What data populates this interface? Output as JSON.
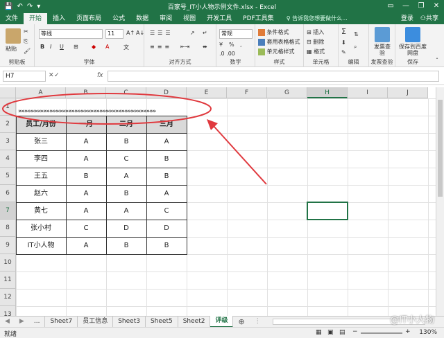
{
  "window": {
    "title": "百家号_IT小人物示例文件.xlsx - Excel",
    "controls": [
      "▭",
      "—",
      "❐",
      "✕"
    ]
  },
  "quick_access": {
    "save": "💾",
    "undo": "↶",
    "redo": "↷",
    "more": "▾"
  },
  "ribbon_tabs": [
    "文件",
    "开始",
    "插入",
    "页面布局",
    "公式",
    "数据",
    "审阅",
    "视图",
    "开发工具",
    "PDF工具集"
  ],
  "active_tab": "开始",
  "tell_me": "告诉我您想要做什么...",
  "account": {
    "login": "登录",
    "share": "共享"
  },
  "ribbon": {
    "clipboard": {
      "paste": "粘贴",
      "label": "剪贴板"
    },
    "font": {
      "name": "等线",
      "size": "11",
      "label": "字体",
      "bold": "B",
      "italic": "I",
      "underline": "U"
    },
    "alignment": {
      "label": "对齐方式"
    },
    "number": {
      "format": "常规",
      "percent": "%",
      "comma": ",",
      "label": "数字"
    },
    "styles": {
      "conditional": "条件格式",
      "table": "套用表格格式",
      "cell": "单元格样式",
      "label": "样式"
    },
    "cells": {
      "insert": "插入",
      "delete": "删除",
      "format": "格式",
      "label": "单元格"
    },
    "editing": {
      "sum": "Σ",
      "label": "编辑"
    },
    "invoice": {
      "check": "发票查验",
      "label": "发票查验"
    },
    "save": {
      "baidu": "保存到百度网盘",
      "label": "保存"
    }
  },
  "formula_bar": {
    "name_box": "H7",
    "fx": "fx",
    "value": ""
  },
  "columns": [
    "A",
    "B",
    "C",
    "D",
    "E",
    "F",
    "G",
    "H",
    "I",
    "J"
  ],
  "selected_column": "H",
  "rows": [
    "1",
    "2",
    "3",
    "4",
    "5",
    "6",
    "7",
    "8",
    "9",
    "10",
    "11",
    "12",
    "13"
  ],
  "row1_text": "»»»»»»»»»»»»»»»»»»»»»»»»»»»»»»»»»»»»»»»»»»»»",
  "table": {
    "headers": [
      "员工/月份",
      "一月",
      "二月",
      "三月"
    ],
    "rows": [
      [
        "张三",
        "A",
        "B",
        "A"
      ],
      [
        "李四",
        "A",
        "C",
        "B"
      ],
      [
        "王五",
        "B",
        "A",
        "B"
      ],
      [
        "赵六",
        "A",
        "B",
        "A"
      ],
      [
        "黄七",
        "A",
        "A",
        "C"
      ],
      [
        "张小村",
        "C",
        "D",
        "D"
      ],
      [
        "IT小人物",
        "A",
        "B",
        "B"
      ]
    ]
  },
  "sheet_tabs": [
    "Sheet7",
    "员工信息",
    "Sheet3",
    "Sheet5",
    "Sheet2",
    "评级"
  ],
  "active_sheet": "评级",
  "sheet_nav": "...",
  "add_sheet": "⊕",
  "status": {
    "ready": "就绪",
    "zoom": "130%"
  },
  "watermark": "@IT小人物",
  "colors": {
    "excel_green": "#217346",
    "annotation_red": "#e0393e"
  }
}
